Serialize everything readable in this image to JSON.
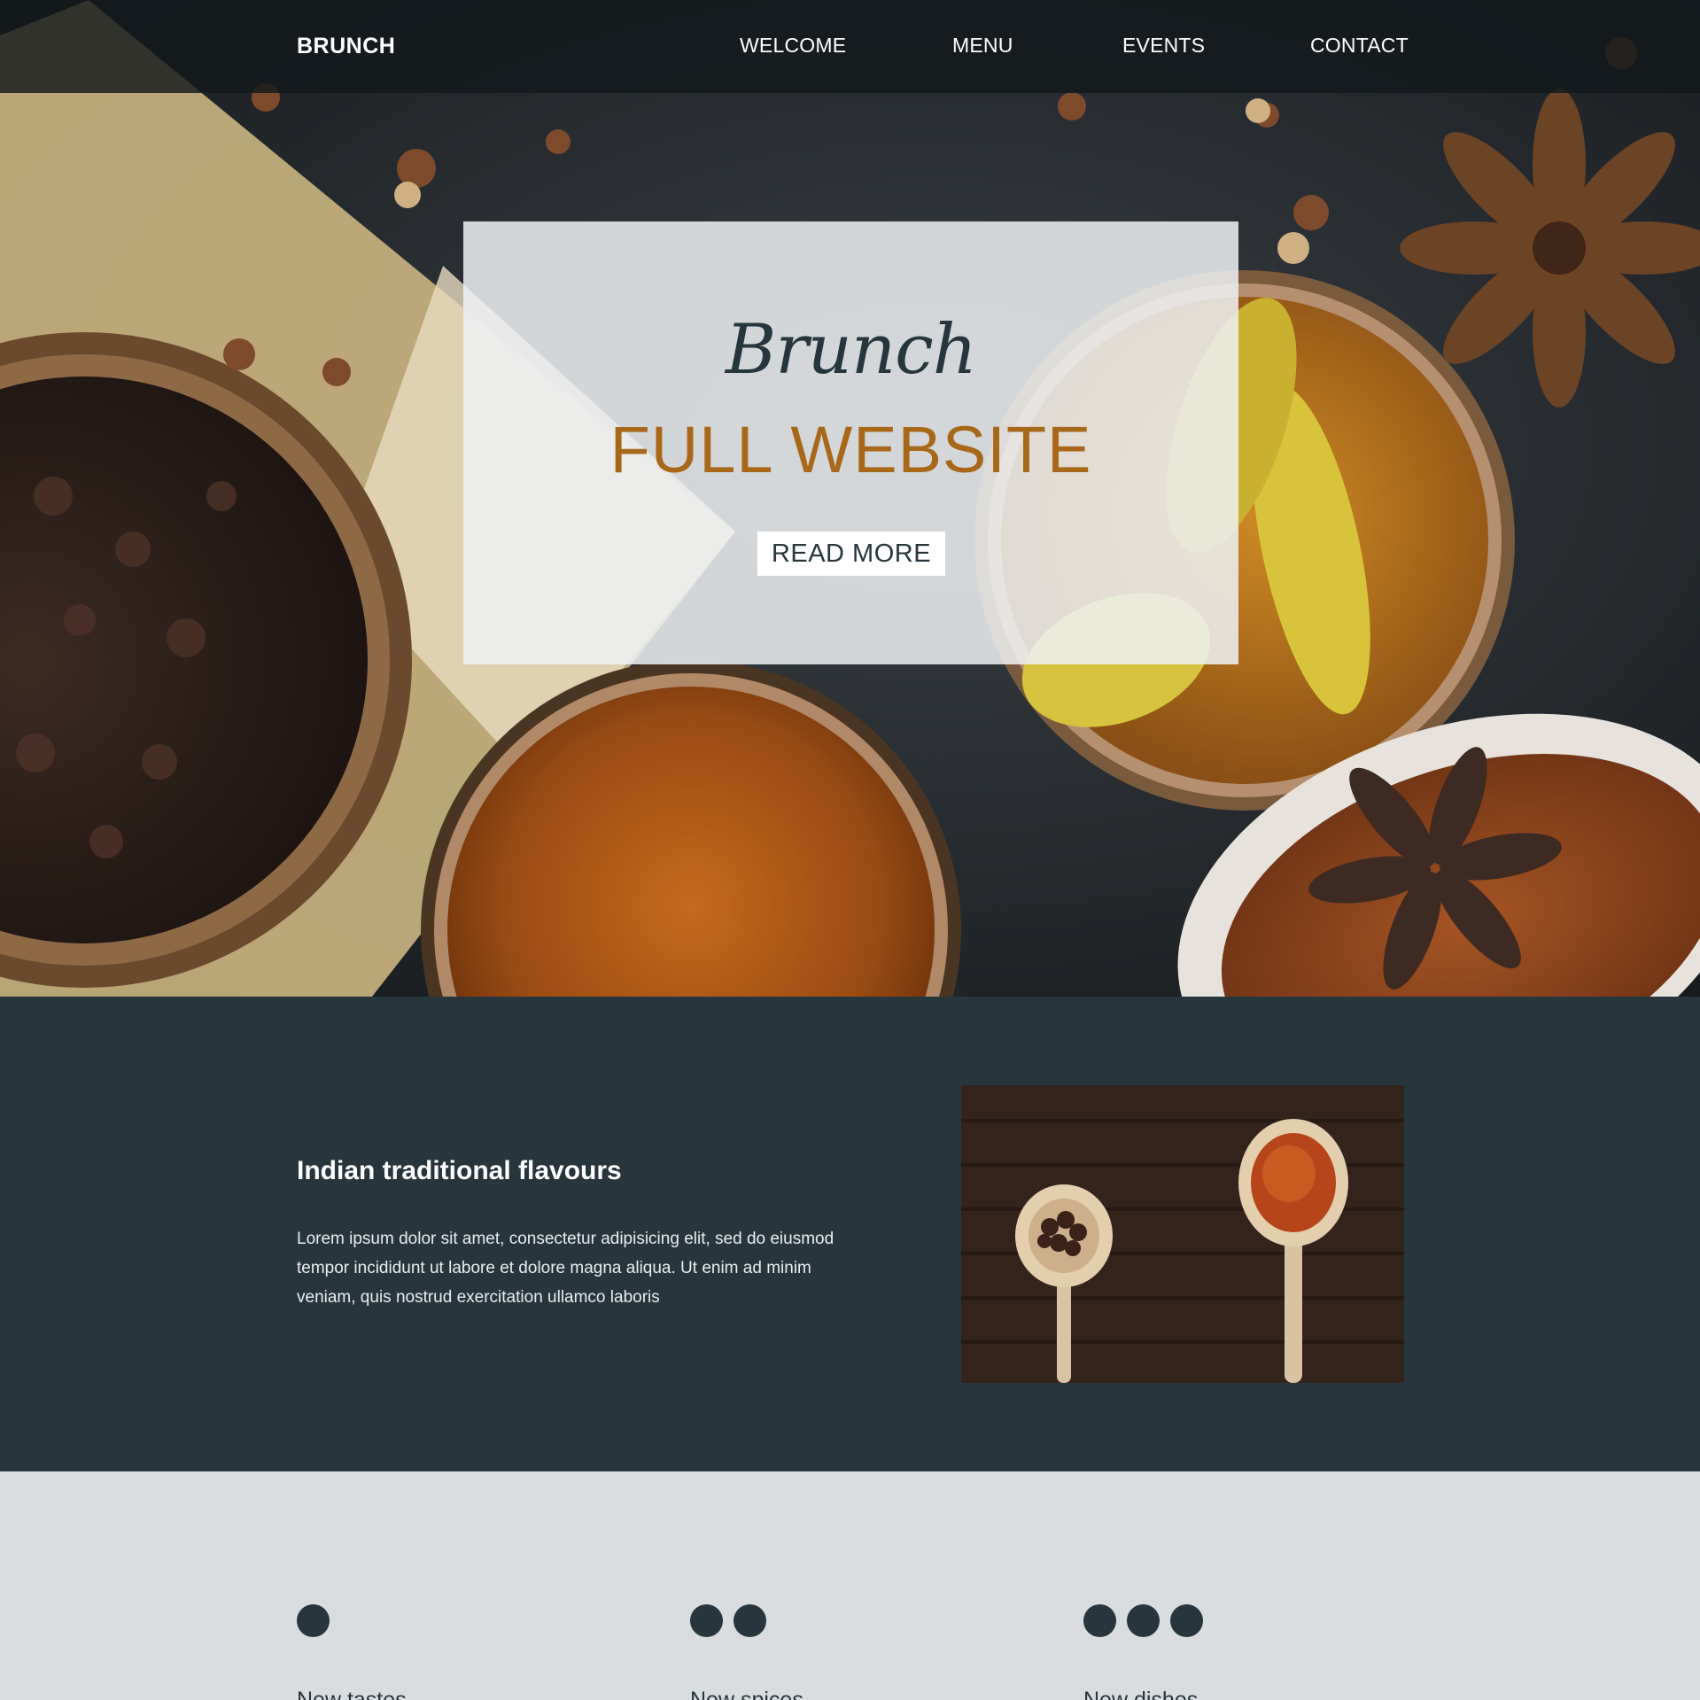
{
  "header": {
    "brand": "BRUNCH",
    "nav": [
      {
        "label": "WELCOME"
      },
      {
        "label": "MENU"
      },
      {
        "label": "EVENTS"
      },
      {
        "label": "CONTACT"
      }
    ]
  },
  "hero": {
    "script_title": "Brunch",
    "title": "FULL WEBSITE",
    "button_label": "READ MORE",
    "colors": {
      "title": "#a8681a",
      "script": "#26363d"
    }
  },
  "about": {
    "heading": "Indian traditional flavours",
    "body": "Lorem ipsum dolor sit amet, consectetur adipisicing elit, sed do eiusmod tempor incididunt ut labore et dolore magna aliqua. Ut enim ad minim veniam, quis nostrud exercitation ullamco laboris",
    "background_color": "#27363d"
  },
  "features": [
    {
      "title": "New tastes",
      "dots": 1
    },
    {
      "title": "New spices",
      "dots": 2
    },
    {
      "title": "New dishes",
      "dots": 3
    }
  ]
}
